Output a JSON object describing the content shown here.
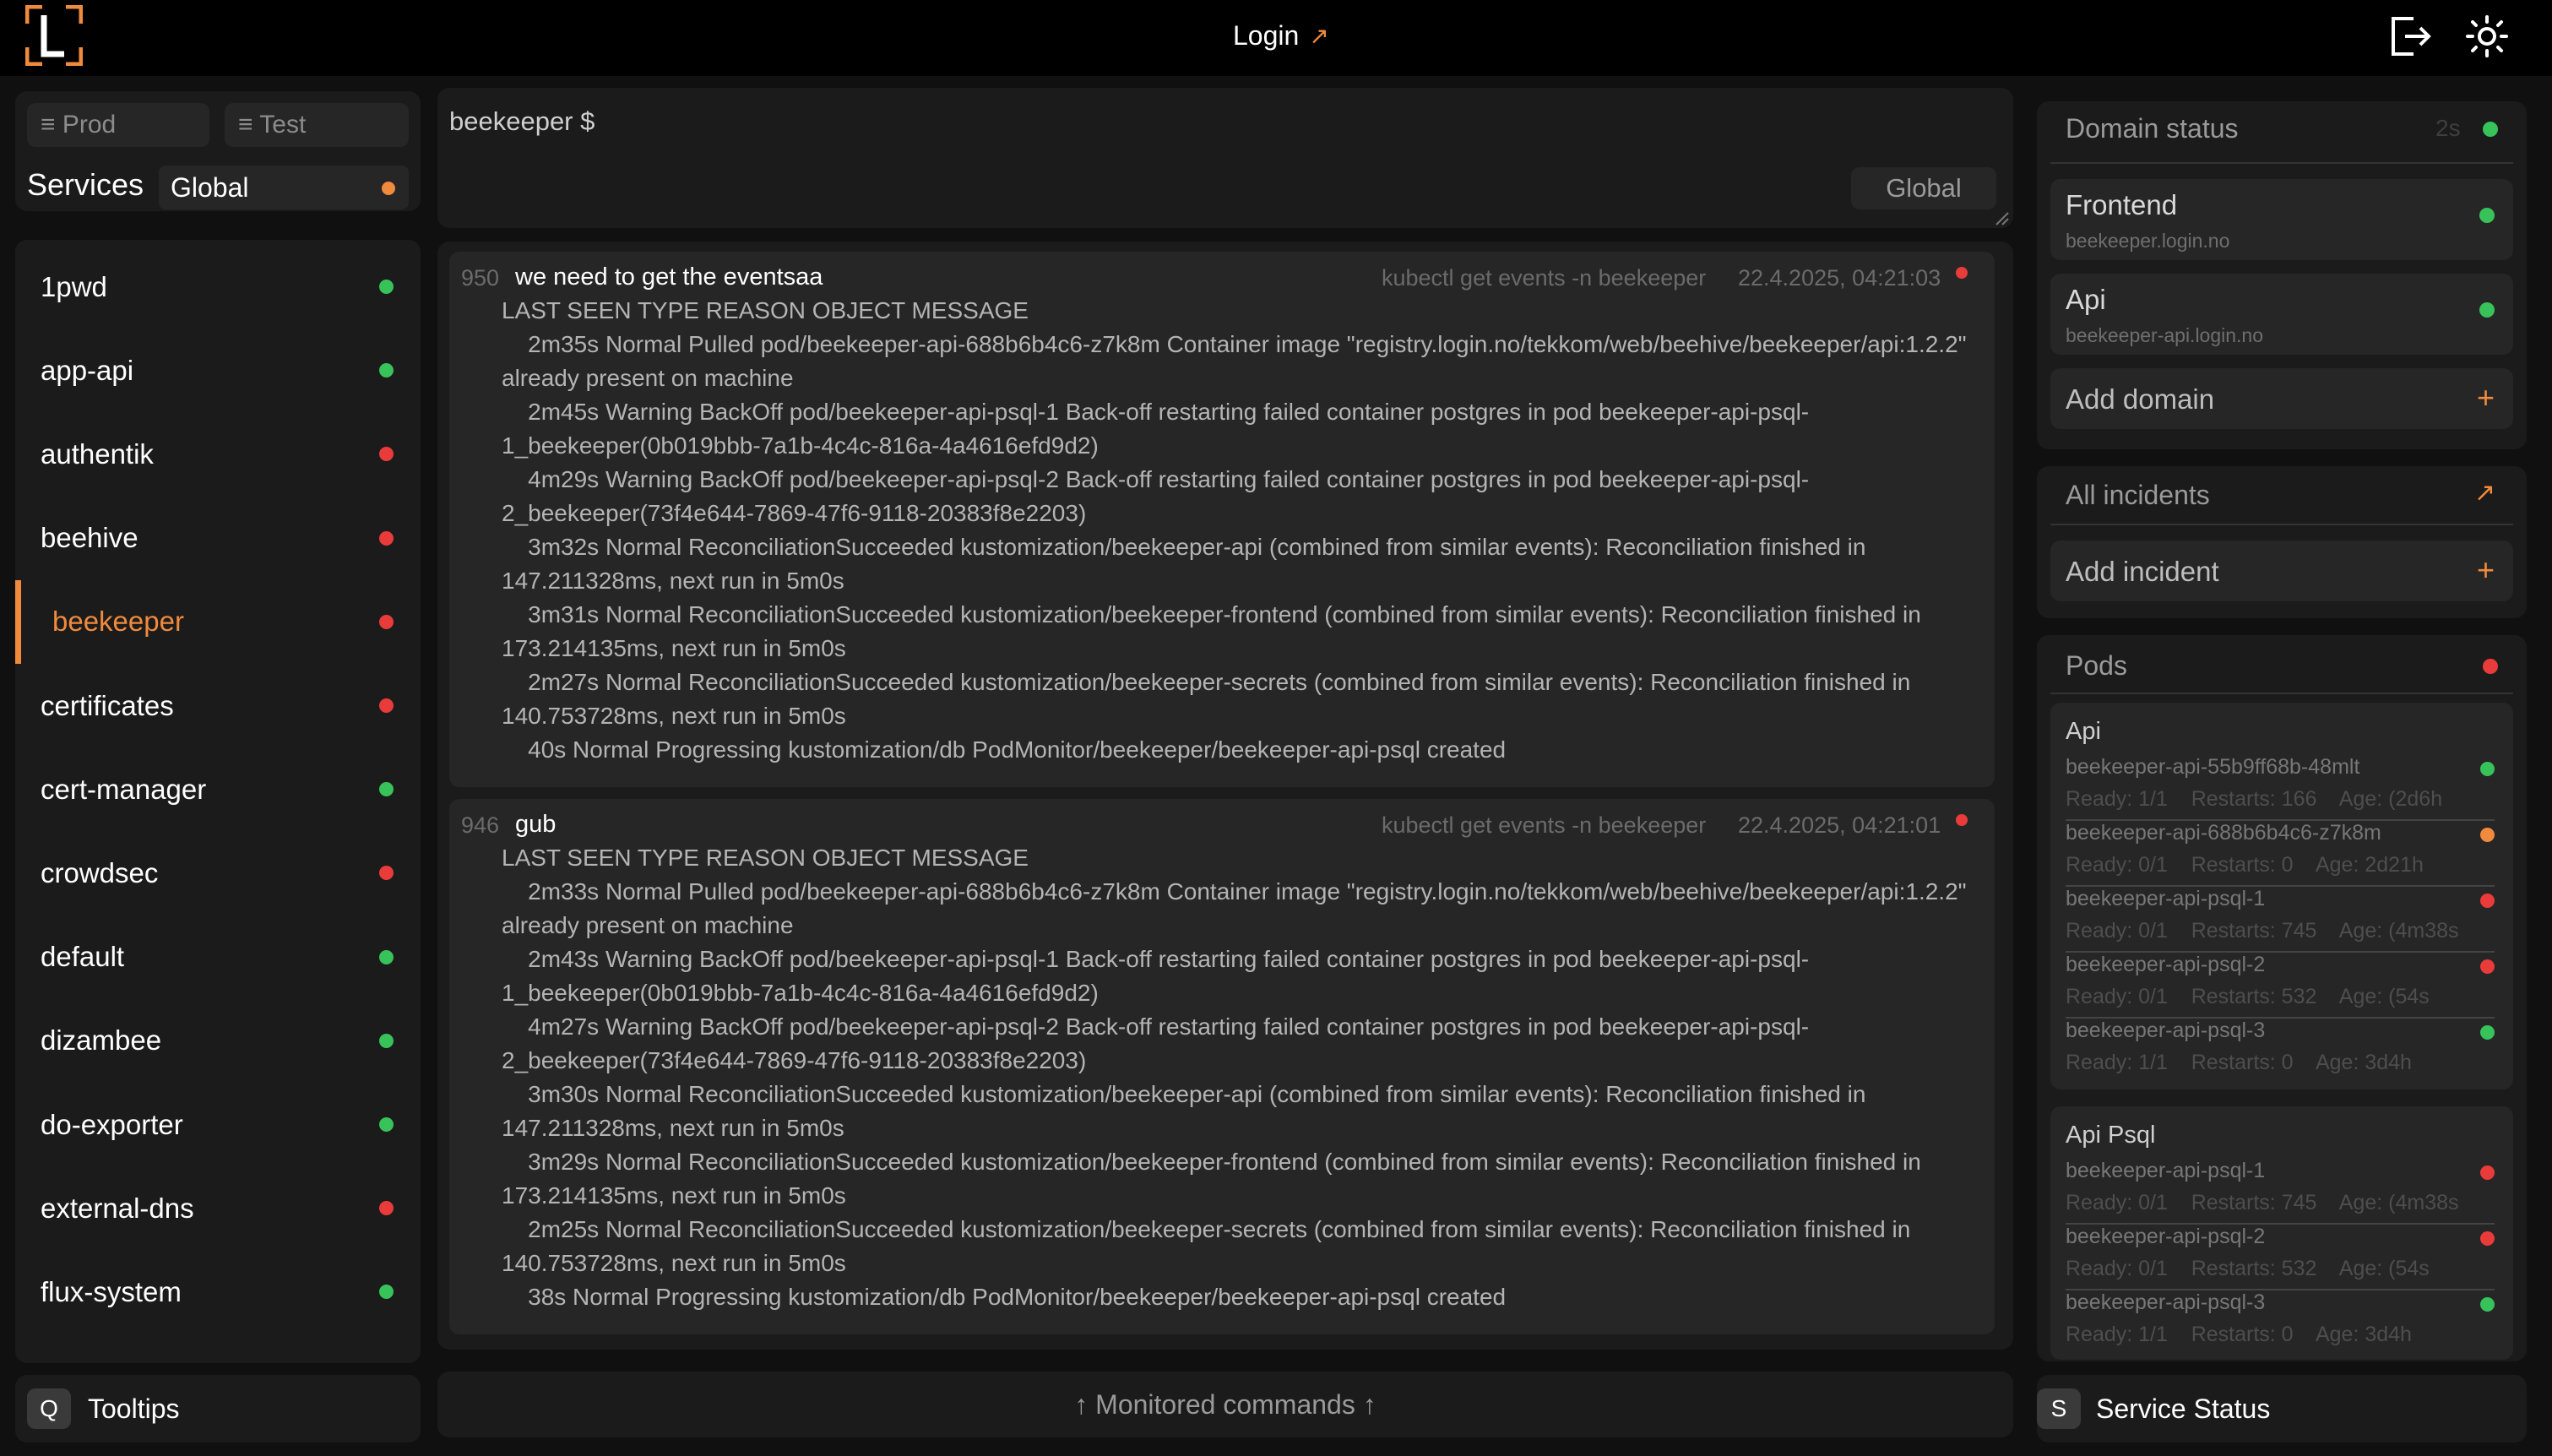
{
  "header": {
    "login_label": "Login",
    "login_arrow": "↗"
  },
  "env_tabs": [
    {
      "label": "≡ Prod"
    },
    {
      "label": "≡ Test"
    }
  ],
  "services": {
    "title": "Services",
    "scope_value": "Global",
    "items": [
      {
        "name": "1pwd",
        "status": "ok"
      },
      {
        "name": "app-api",
        "status": "ok"
      },
      {
        "name": "authentik",
        "status": "error"
      },
      {
        "name": "beehive",
        "status": "error"
      },
      {
        "name": "beekeeper",
        "status": "error",
        "active": true
      },
      {
        "name": "certificates",
        "status": "error"
      },
      {
        "name": "cert-manager",
        "status": "ok"
      },
      {
        "name": "crowdsec",
        "status": "error"
      },
      {
        "name": "default",
        "status": "ok"
      },
      {
        "name": "dizambee",
        "status": "ok"
      },
      {
        "name": "do-exporter",
        "status": "ok"
      },
      {
        "name": "external-dns",
        "status": "error"
      },
      {
        "name": "flux-system",
        "status": "ok"
      }
    ]
  },
  "command": {
    "prompt": "beekeeper $",
    "scope": "Global"
  },
  "logs": [
    {
      "id": "950",
      "title": "we need to get the eventsaa",
      "command": "kubectl get events -n beekeeper",
      "time": "22.4.2025, 04:21:03",
      "lines": [
        "LAST SEEN TYPE REASON OBJECT MESSAGE",
        "    2m35s Normal Pulled pod/beekeeper-api-688b6b4c6-z7k8m Container image \"registry.login.no/tekkom/web/beehive/beekeeper/api:1.2.2\" already present on machine",
        "    2m45s Warning BackOff pod/beekeeper-api-psql-1 Back-off restarting failed container postgres in pod beekeeper-api-psql-1_beekeeper(0b019bbb-7a1b-4c4c-816a-4a4616efd9d2)",
        "    4m29s Warning BackOff pod/beekeeper-api-psql-2 Back-off restarting failed container postgres in pod beekeeper-api-psql-2_beekeeper(73f4e644-7869-47f6-9118-20383f8e2203)",
        "    3m32s Normal ReconciliationSucceeded kustomization/beekeeper-api (combined from similar events): Reconciliation finished in 147.211328ms, next run in 5m0s",
        "    3m31s Normal ReconciliationSucceeded kustomization/beekeeper-frontend (combined from similar events): Reconciliation finished in 173.214135ms, next run in 5m0s",
        "    2m27s Normal ReconciliationSucceeded kustomization/beekeeper-secrets (combined from similar events): Reconciliation finished in 140.753728ms, next run in 5m0s",
        "    40s Normal Progressing kustomization/db PodMonitor/beekeeper/beekeeper-api-psql created"
      ]
    },
    {
      "id": "946",
      "title": "gub",
      "command": "kubectl get events -n beekeeper",
      "time": "22.4.2025, 04:21:01",
      "lines": [
        "LAST SEEN TYPE REASON OBJECT MESSAGE",
        "    2m33s Normal Pulled pod/beekeeper-api-688b6b4c6-z7k8m Container image \"registry.login.no/tekkom/web/beehive/beekeeper/api:1.2.2\" already present on machine",
        "    2m43s Warning BackOff pod/beekeeper-api-psql-1 Back-off restarting failed container postgres in pod beekeeper-api-psql-1_beekeeper(0b019bbb-7a1b-4c4c-816a-4a4616efd9d2)",
        "    4m27s Warning BackOff pod/beekeeper-api-psql-2 Back-off restarting failed container postgres in pod beekeeper-api-psql-2_beekeeper(73f4e644-7869-47f6-9118-20383f8e2203)",
        "    3m30s Normal ReconciliationSucceeded kustomization/beekeeper-api (combined from similar events): Reconciliation finished in 147.211328ms, next run in 5m0s",
        "    3m29s Normal ReconciliationSucceeded kustomization/beekeeper-frontend (combined from similar events): Reconciliation finished in 173.214135ms, next run in 5m0s",
        "    2m25s Normal ReconciliationSucceeded kustomization/beekeeper-secrets (combined from similar events): Reconciliation finished in 140.753728ms, next run in 5m0s",
        "    38s Normal Progressing kustomization/db PodMonitor/beekeeper/beekeeper-api-psql created"
      ]
    }
  ],
  "monitored_label": "↑ Monitored commands ↑",
  "domain_status": {
    "title": "Domain status",
    "refresh": "2s",
    "domains": [
      {
        "name": "Frontend",
        "url": "beekeeper.login.no"
      },
      {
        "name": "Api",
        "url": "beekeeper-api.login.no"
      }
    ],
    "add_label": "Add domain"
  },
  "incidents": {
    "title": "All incidents",
    "add_label": "Add incident"
  },
  "pods": {
    "title": "Pods",
    "groups": [
      {
        "title": "Api",
        "items": [
          {
            "name": "beekeeper-api-55b9ff68b-48mlt",
            "meta": "Ready: 1/1    Restarts: 166    Age: (2d6h",
            "status": "ok"
          },
          {
            "name": "beekeeper-api-688b6b4c6-z7k8m",
            "meta": "Ready: 0/1    Restarts: 0    Age: 2d21h",
            "status": "warn"
          },
          {
            "name": "beekeeper-api-psql-1",
            "meta": "Ready: 0/1    Restarts: 745    Age: (4m38s",
            "status": "error"
          },
          {
            "name": "beekeeper-api-psql-2",
            "meta": "Ready: 0/1    Restarts: 532    Age: (54s",
            "status": "error"
          },
          {
            "name": "beekeeper-api-psql-3",
            "meta": "Ready: 1/1    Restarts: 0    Age: 3d4h",
            "status": "ok"
          }
        ]
      },
      {
        "title": "Api Psql",
        "items": [
          {
            "name": "beekeeper-api-psql-1",
            "meta": "Ready: 0/1    Restarts: 745    Age: (4m38s",
            "status": "error"
          },
          {
            "name": "beekeeper-api-psql-2",
            "meta": "Ready: 0/1    Restarts: 532    Age: (54s",
            "status": "error"
          },
          {
            "name": "beekeeper-api-psql-3",
            "meta": "Ready: 1/1    Restarts: 0    Age: 3d4h",
            "status": "ok"
          }
        ]
      }
    ]
  },
  "footer": {
    "tooltips_key": "Q",
    "tooltips_label": "Tooltips",
    "status_key": "S",
    "status_label": "Service Status"
  },
  "colors": {
    "accent": "#f08a3c",
    "ok": "#38c25a",
    "error": "#ea3b3b",
    "background": "#101010",
    "panel": "#1b1b1b"
  }
}
